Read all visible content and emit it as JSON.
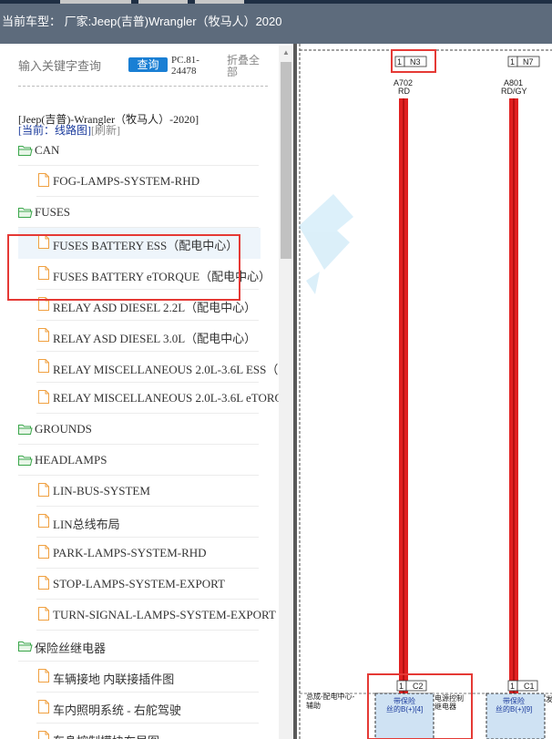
{
  "header": {
    "title": "当前车型： 厂家:Jeep(吉普)Wrangler（牧马人）2020"
  },
  "search": {
    "placeholder": "输入关键字查询",
    "button_label": "查询",
    "pc_code": "PC.81-24478",
    "collapse_label": "折叠全部"
  },
  "tree": {
    "path": "[Jeep(吉普)-Wrangler（牧马人）-2020]",
    "current_prefix": "[当前：线路图]",
    "refresh_label": "[刷新]",
    "items": [
      {
        "label": "CAN",
        "type": "folder"
      },
      {
        "label": "FOG-LAMPS-SYSTEM-RHD",
        "type": "file"
      },
      {
        "label": "FUSES",
        "type": "folder"
      },
      {
        "label": "FUSES BATTERY ESS（配电中心）",
        "type": "file",
        "selected": true
      },
      {
        "label": "FUSES BATTERY eTORQUE（配电中心）",
        "type": "file"
      },
      {
        "label": "RELAY ASD DIESEL 2.2L（配电中心）",
        "type": "file"
      },
      {
        "label": "RELAY ASD DIESEL 3.0L（配电中心）",
        "type": "file"
      },
      {
        "label": "RELAY MISCELLANEOUS 2.0L-3.6L ESS（",
        "type": "file"
      },
      {
        "label": "RELAY MISCELLANEOUS 2.0L-3.6L eTORQ",
        "type": "file"
      },
      {
        "label": "GROUNDS",
        "type": "folder"
      },
      {
        "label": "HEADLAMPS",
        "type": "folder"
      },
      {
        "label": "LIN-BUS-SYSTEM",
        "type": "file"
      },
      {
        "label": "LIN总线布局",
        "type": "file"
      },
      {
        "label": "PARK-LAMPS-SYSTEM-RHD",
        "type": "file"
      },
      {
        "label": "STOP-LAMPS-SYSTEM-EXPORT",
        "type": "file"
      },
      {
        "label": "TURN-SIGNAL-LAMPS-SYSTEM-EXPORT",
        "type": "file"
      },
      {
        "label": "保险丝继电器",
        "type": "folder"
      },
      {
        "label": "车辆接地 内联接插件图",
        "type": "file"
      },
      {
        "label": "车内照明系统 - 右舵驾驶",
        "type": "file"
      },
      {
        "label": "车身控制模块布局图",
        "type": "file"
      }
    ]
  },
  "diagram": {
    "wire1": {
      "pin": "1",
      "connector": "N3",
      "circuit": "A702",
      "color_code": "RD",
      "bottom_pin": "1",
      "bottom_connector": "C2"
    },
    "wire2": {
      "pin": "1",
      "connector": "N7",
      "circuit": "A801",
      "color_code": "RD/GY",
      "bottom_pin": "1",
      "bottom_connector": "C1"
    },
    "module_label_1": "总成-配电中心-",
    "module_label_2": "辅助",
    "fuse1_line1": "带保险",
    "fuse1_line2": "丝的B(+)",
    "fuse1_suffix": "4",
    "relay_line1": "电源控制",
    "relay_line2": "继电器",
    "fuse2_line1": "带保险",
    "fuse2_line2": "丝的B(+)",
    "fuse2_suffix": "9",
    "edge_char": "发"
  },
  "colors": {
    "wire_red": "#e02020",
    "highlight_red": "#e53935",
    "header_bg": "#5d6b7c",
    "button_blue": "#1a7fd4",
    "fuse_fill": "#cfe2f3"
  },
  "icons": {
    "folder": "folder-open-icon",
    "file": "file-icon"
  }
}
